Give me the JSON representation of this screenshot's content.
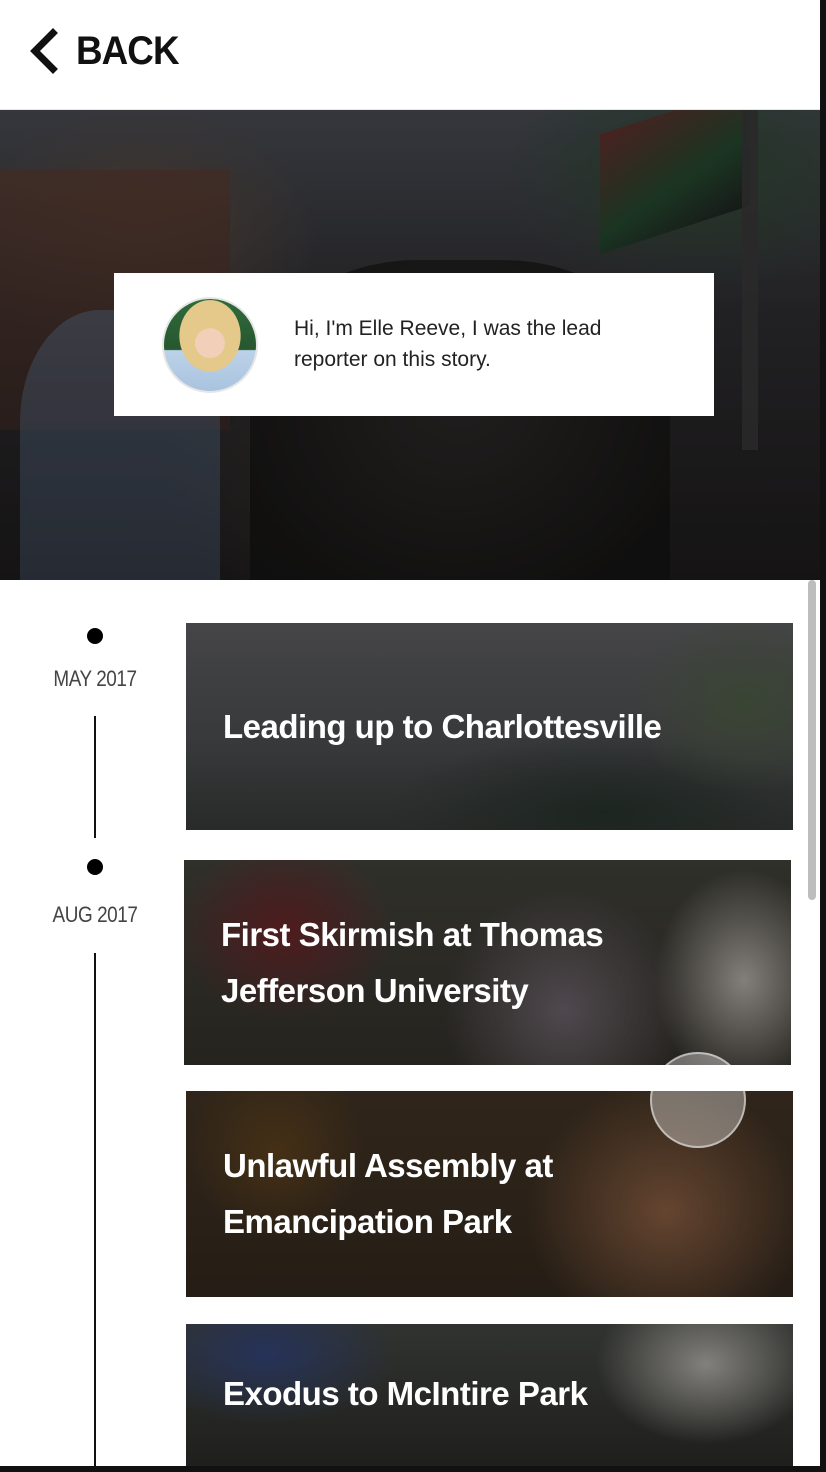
{
  "header": {
    "back_label": "BACK",
    "back_icon": "chevron-left-icon"
  },
  "reporter": {
    "intro": "Hi, I'm Elle Reeve, I was the lead reporter on this story."
  },
  "timeline": {
    "dates": [
      "MAY 2017",
      "AUG 2017"
    ],
    "stories": [
      {
        "title": "Leading up to Charlottesville"
      },
      {
        "title": "First Skirmish at Thomas Jefferson University"
      },
      {
        "title": "Unlawful Assembly at Emancipation Park"
      },
      {
        "title": "Exodus to McIntire Park"
      }
    ]
  },
  "colors": {
    "accent": "#000000",
    "text_on_image": "#ffffff"
  }
}
